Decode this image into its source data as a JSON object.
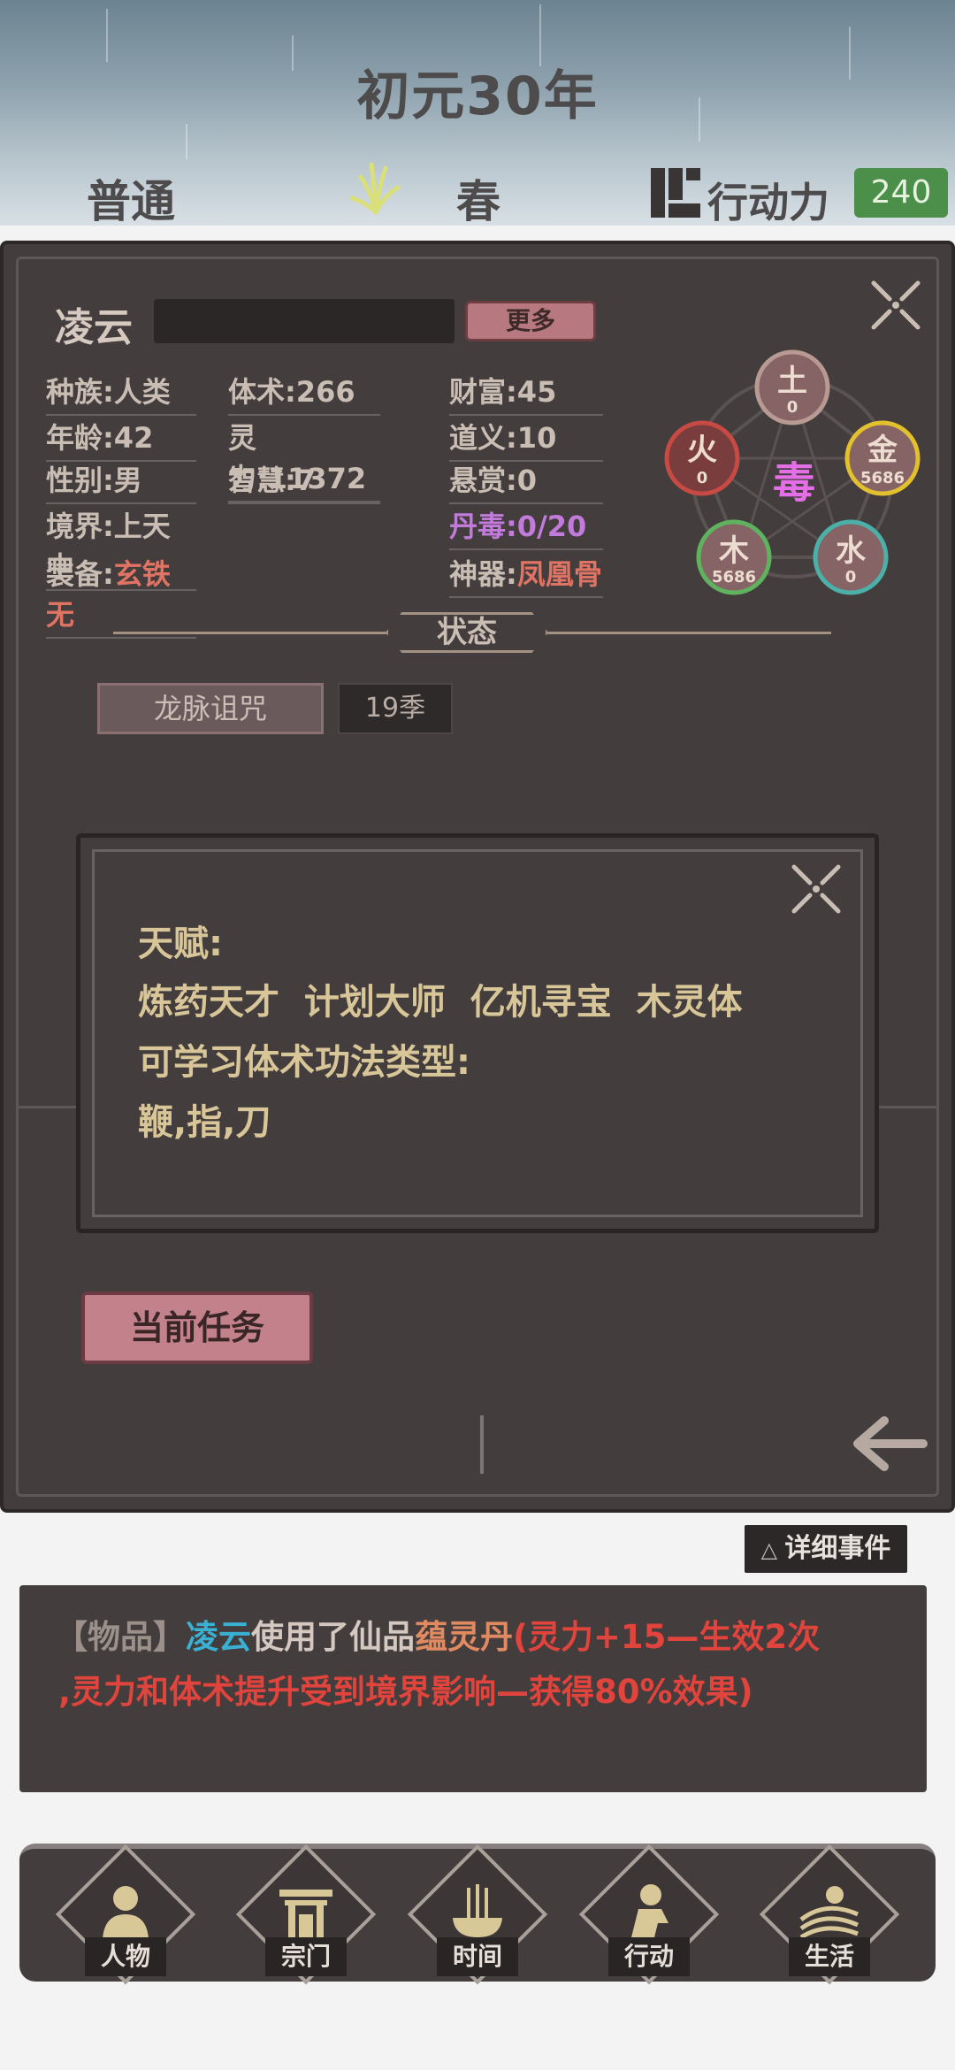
{
  "header": {
    "year": "初元30年",
    "mode": "普通",
    "season": "春",
    "action_label": "行动力",
    "action_value": "240"
  },
  "character": {
    "name": "凌云",
    "more_label": "更多",
    "stats": {
      "race": "种族:人类",
      "age": "年龄:42",
      "gender": "性别:男",
      "realm": "境界:上天中",
      "equip_label": "装备:",
      "equip_value": "玄铁无",
      "body": "体术:266",
      "spirit": "灵力:11372",
      "wisdom": "智慧:7",
      "wealth": "财富:45",
      "virtue": "道义:10",
      "bounty": "悬赏:0",
      "poison": "丹毒:0/20",
      "artifact_label": "神器:",
      "artifact_value": "凤凰骨"
    }
  },
  "elements": {
    "center": "毒",
    "earth": {
      "label": "土",
      "value": "0"
    },
    "fire": {
      "label": "火",
      "value": "0"
    },
    "metal": {
      "label": "金",
      "value": "5686"
    },
    "wood": {
      "label": "木",
      "value": "5686"
    },
    "water": {
      "label": "水",
      "value": "0"
    }
  },
  "status": {
    "title": "状态",
    "effect_name": "龙脉诅咒",
    "effect_duration": "19季"
  },
  "talent_dialog": {
    "line1": "天赋:",
    "line2": "炼药天才  计划大师  亿机寻宝  木灵体",
    "line3": "可学习体术功法类型:",
    "line4": "鞭,指,刀"
  },
  "task_button": "当前任务",
  "log": {
    "detail_button": "详细事件",
    "tag": "【物品】",
    "actor": "凌云",
    "verb": "使用了仙品",
    "item": "蕴灵丹",
    "effect1": "(灵力+15—生效2次",
    "effect2": ",灵力和体术提升受到境界影响—获得80%效果)"
  },
  "nav": [
    {
      "label": "人物",
      "icon": "person-icon"
    },
    {
      "label": "宗门",
      "icon": "sect-gate-icon"
    },
    {
      "label": "时间",
      "icon": "incense-icon"
    },
    {
      "label": "行动",
      "icon": "action-icon"
    },
    {
      "label": "生活",
      "icon": "life-icon"
    }
  ],
  "colors": {
    "panel": "#433d3d",
    "accent_pink": "#c2818b",
    "action_green": "#4b8f4a",
    "log_red": "#e0443c",
    "log_cyan": "#3ab0d2"
  }
}
